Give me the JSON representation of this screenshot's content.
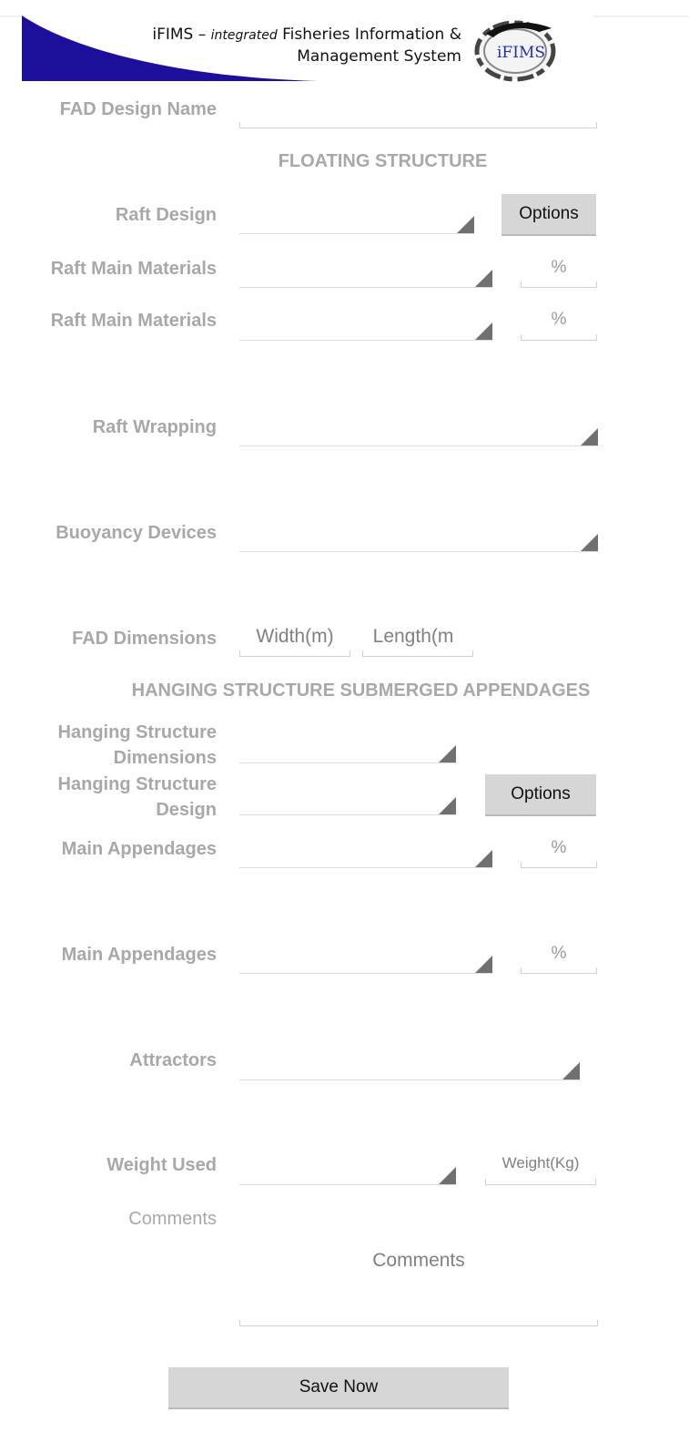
{
  "header": {
    "title_prefix": "iFIMS –",
    "title_italic": "integrated",
    "title_line1_rest": "Fisheries Information &",
    "title_line2": "Management System",
    "logo_text": "iFIMS"
  },
  "form": {
    "fad_design_name_label": "FAD Design Name",
    "floating_structure_heading": "FLOATING STRUCTURE",
    "raft_design_label": "Raft Design",
    "raft_design_options_button": "Options",
    "raft_main_materials_1_label": "Raft Main Materials",
    "raft_main_materials_1_pct_placeholder": "%",
    "raft_main_materials_2_label": "Raft Main Materials",
    "raft_main_materials_2_pct_placeholder": "%",
    "raft_wrapping_label": "Raft Wrapping",
    "buoyancy_devices_label": "Buoyancy Devices",
    "fad_dimensions_label": "FAD Dimensions",
    "width_placeholder": "Width(m)",
    "length_placeholder": "Length(m",
    "hanging_heading": "HANGING STRUCTURE SUBMERGED APPENDAGES",
    "hanging_dimensions_label": "Hanging Structure Dimensions",
    "hanging_design_label": "Hanging Structure Design",
    "hanging_design_options_button": "Options",
    "main_appendages_1_label": "Main Appendages",
    "main_appendages_1_pct_placeholder": "%",
    "main_appendages_2_label": "Main Appendages",
    "main_appendages_2_pct_placeholder": "%",
    "attractors_label": "Attractors",
    "weight_used_label": "Weight Used",
    "weight_placeholder": "Weight(Kg)",
    "comments_label": "Comments",
    "comments_placeholder": "Comments",
    "save_button": "Save Now"
  }
}
